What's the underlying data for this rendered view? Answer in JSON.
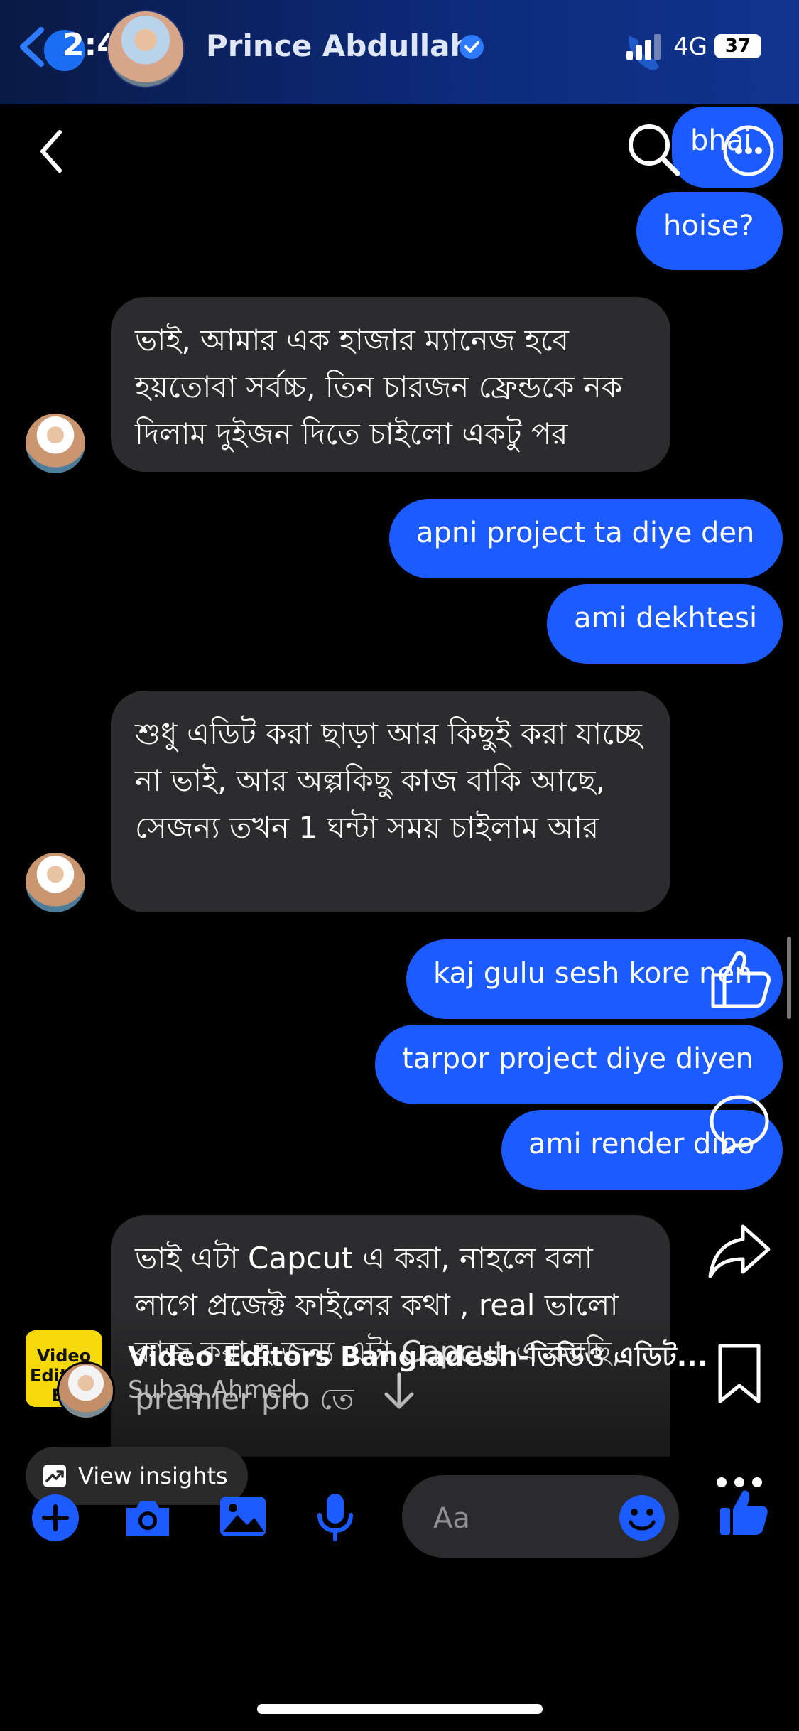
{
  "status": {
    "time": "2:48",
    "network": "4G",
    "battery": "37"
  },
  "header": {
    "contact_name": "Prince Abdullah"
  },
  "messages": [
    {
      "dir": "out",
      "text": "bhai"
    },
    {
      "dir": "out",
      "text": "hoise?"
    },
    {
      "dir": "in",
      "text": "ভাই, আমার এক হাজার ম্যানেজ হবে হয়তোবা সর্বচ্চ, তিন চারজন ফ্রেন্ডকে নক দিলাম দুইজন দিতে চাইলো একটু পর"
    },
    {
      "dir": "out",
      "text": "apni project ta diye den"
    },
    {
      "dir": "out",
      "text": "ami dekhtesi"
    },
    {
      "dir": "in",
      "text": "শুধু এডিট করা ছাড়া আর কিছুই করা যাচ্ছে না ভাই, আর অল্পকিছু কাজ বাকি আছে, সেজন্য তখন 1 ঘন্টা সময় চাইলাম আর"
    },
    {
      "dir": "out",
      "text": "kaj gulu sesh kore nen"
    },
    {
      "dir": "out",
      "text": "tarpor project diye diyen"
    },
    {
      "dir": "out",
      "text": "ami render dibo"
    },
    {
      "dir": "in",
      "text": "ভাই এটা Capcut এ করা, নাহলে বলা লাগে প্রজেক্ট ফাইলের কথা , real ভালো কাজ করা হ জন্য এটা Capcut এ করছি, premier pro তে"
    }
  ],
  "reel": {
    "page_logo_text": "Video Editors Bo",
    "page_name": "Video Editors Bangladesh-ভিডিও এডিট...",
    "poster_name": "Suhag Ahmed",
    "insights_label": "View insights"
  },
  "composer": {
    "placeholder": "Aa"
  },
  "colors": {
    "accent": "#1c5bff",
    "incoming": "#2c2c2e",
    "header": "#0d2a7a"
  }
}
